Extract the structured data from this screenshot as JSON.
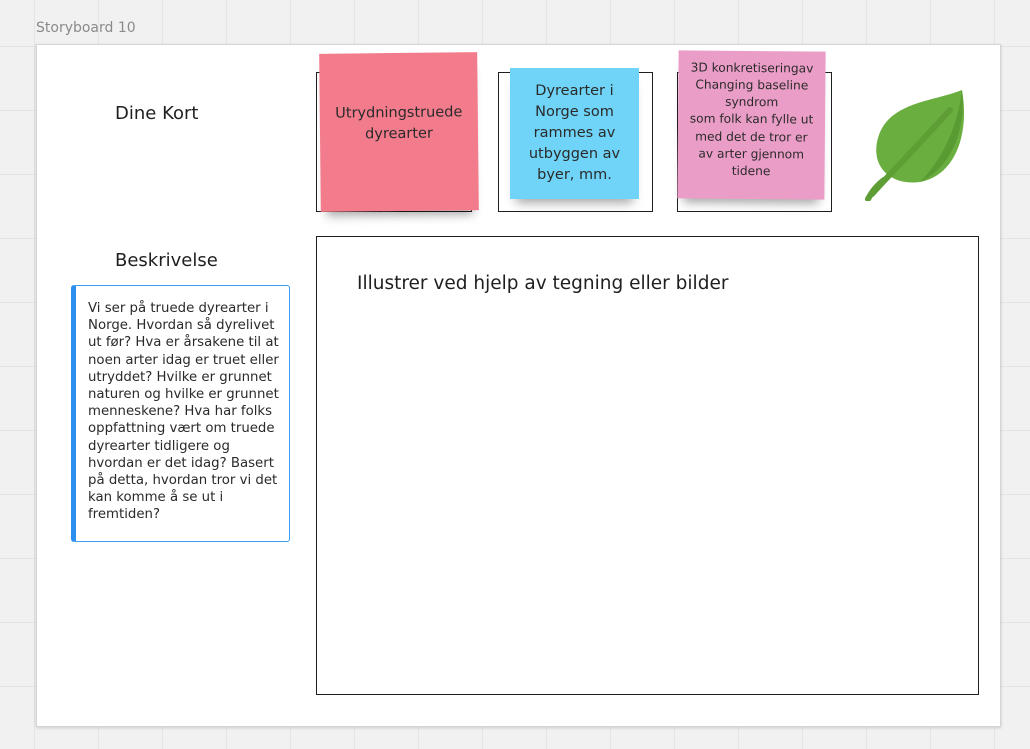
{
  "board": {
    "frame_title": "Storyboard 10"
  },
  "sections": {
    "cards_heading": "Dine Kort",
    "description_heading": "Beskrivelse"
  },
  "stickies": [
    {
      "text": "Utrydningstruede\ndyrearter",
      "color": "#f27b8c"
    },
    {
      "text": "Dyrearter i\nNorge som\nrammes av\nutbyggen av\nbyer, mm.",
      "color": "#6fd4f7"
    },
    {
      "text": "3D konkretiseringav\nChanging baseline\nsyndrom\nsom folk kan fylle ut\nmed det de tror er\nav arter gjennom\ntidene",
      "color": "#ea9dc6"
    }
  ],
  "description": {
    "text": "Vi ser på truede dyrearter i Norge. Hvordan så dyrelivet ut før? Hva er årsakene til at noen arter idag er truet eller utryddet? Hvilke er grunnet naturen og hvilke er grunnet menneskene? Hva har folks oppfattning vært om truede dyrearter tidligere og hvordan er det idag? Basert på detta, hvordan tror vi det kan komme å se ut i fremtiden?",
    "accent_color": "#2d8ff0"
  },
  "drawing_area": {
    "prompt": "Illustrer ved hjelp av tegning eller bilder"
  },
  "icons": {
    "leaf": "leaf-icon",
    "leaf_color": "#6aae3f"
  }
}
